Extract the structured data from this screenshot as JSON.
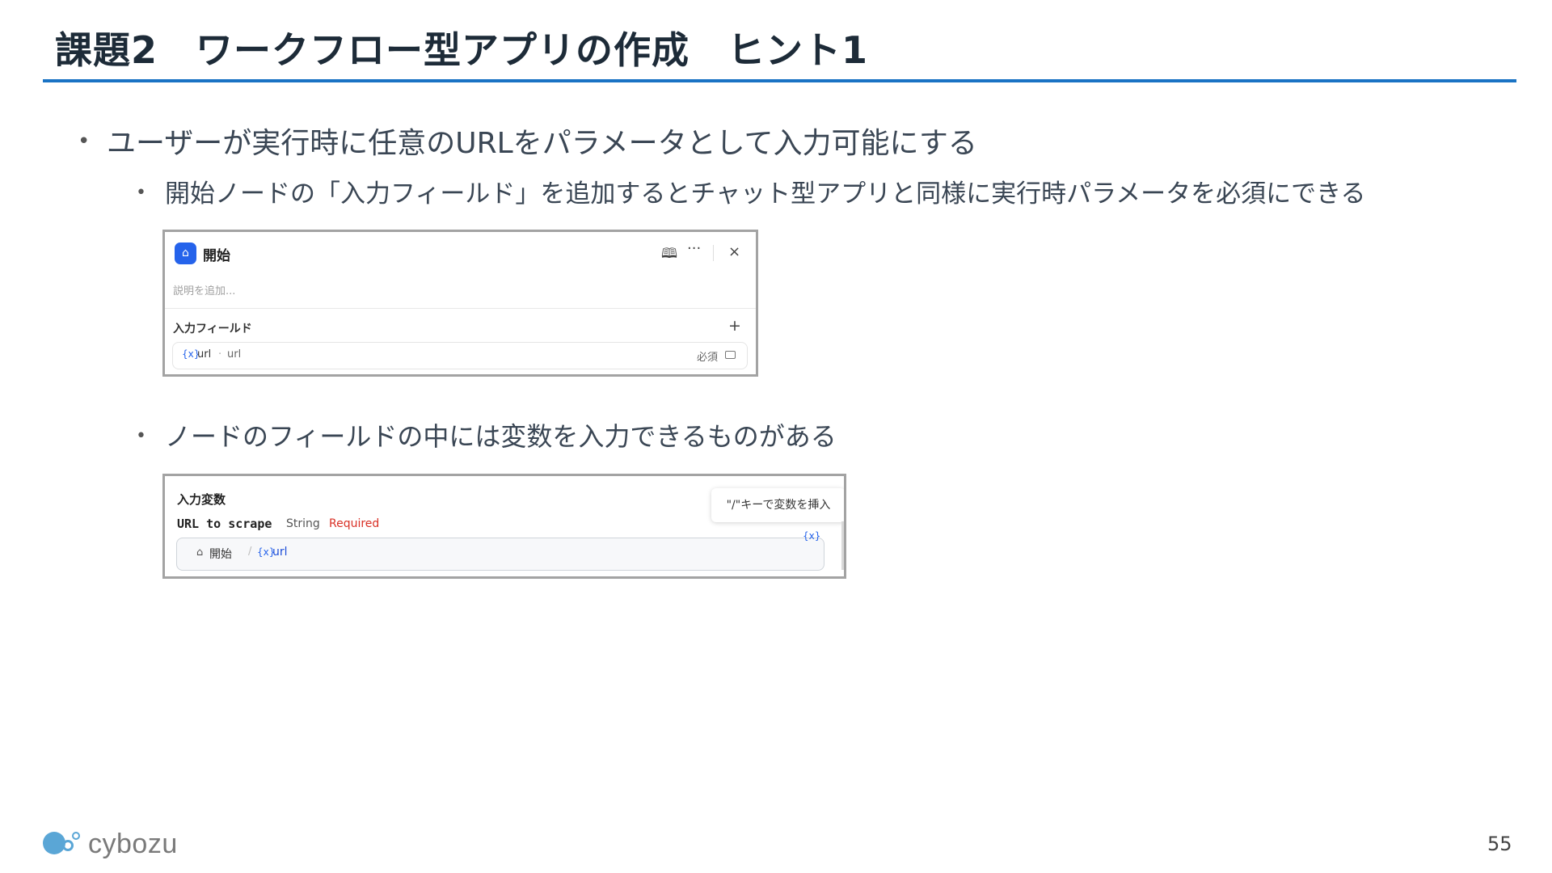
{
  "slide": {
    "title": "課題2　ワークフロー型アプリの作成　ヒント1",
    "page_number": "55",
    "brand": "cybozu",
    "accent_color": "#1a73c4"
  },
  "bullets": [
    {
      "text": "ユーザーが実行時に任意のURLをパラメータとして入力可能にする",
      "level": 1
    },
    {
      "text": "開始ノードの「入力フィールド」を追加するとチャット型アプリと同様に実行時パラメータを必須にできる",
      "level": 2
    },
    {
      "text": "ノードのフィールドの中には変数を入力できるものがある",
      "level": 2
    }
  ],
  "screenshot1": {
    "node_title": "開始",
    "description_placeholder": "説明を追加...",
    "section_title": "入力フィールド",
    "field": {
      "var_icon": "{x}",
      "name": "url",
      "separator": "·",
      "label": "url",
      "required_label": "必須"
    },
    "icons": [
      "home-icon",
      "book-icon",
      "more-icon",
      "close-icon",
      "plus-icon",
      "edit-icon"
    ]
  },
  "screenshot2": {
    "section_title": "入力変数",
    "variable_name": "URL to scrape",
    "variable_type": "String",
    "required_label": "Required",
    "tooltip": "\"/\"キーで変数を挿入",
    "reference": {
      "node": "開始",
      "separator": "/",
      "var_icon": "{x}",
      "variable": "url"
    },
    "insert_icon": "{x}"
  }
}
